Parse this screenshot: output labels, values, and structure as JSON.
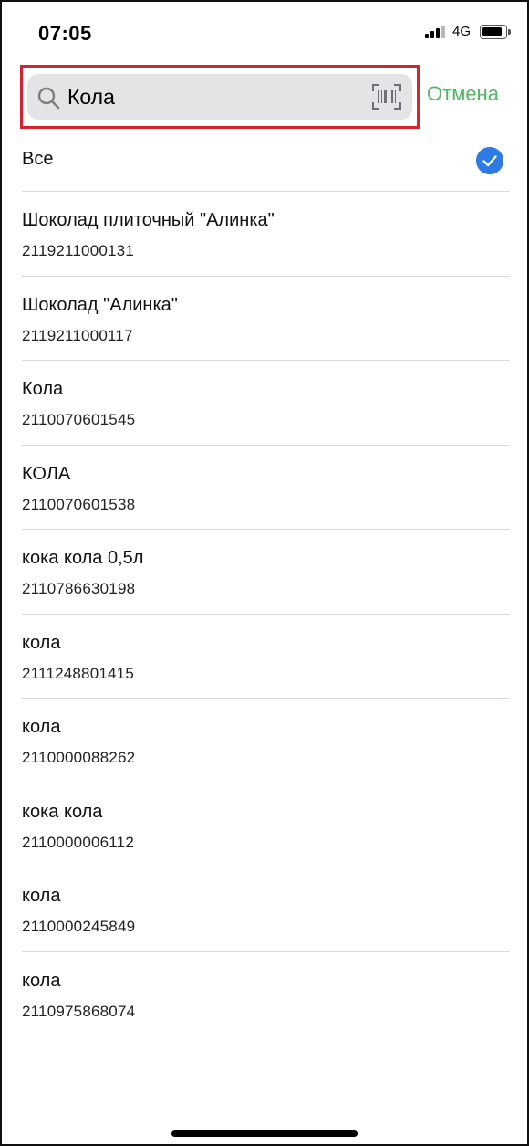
{
  "status_bar": {
    "time": "07:05",
    "network": "4G",
    "signal_icon": "cellular-signal-icon",
    "battery_icon": "battery-icon"
  },
  "search": {
    "value": "Кола",
    "placeholder": "",
    "search_icon": "magnifier-icon",
    "barcode_icon": "barcode-scan-icon",
    "cancel_label": "Отмена",
    "highlight_color": "#d8222f",
    "cancel_color": "#4cbb5f"
  },
  "list": {
    "all_label": "Все",
    "all_selected": true,
    "check_color": "#2f7be6",
    "items": [
      {
        "title": "Шоколад плиточный \"Алинка\"",
        "code": "2119211000131"
      },
      {
        "title": "Шоколад \"Алинка\"",
        "code": "2119211000117"
      },
      {
        "title": "Кола",
        "code": "2110070601545"
      },
      {
        "title": "КОЛА",
        "code": "2110070601538"
      },
      {
        "title": "кока кола 0,5л",
        "code": "2110786630198"
      },
      {
        "title": "кола",
        "code": "2111248801415"
      },
      {
        "title": "кола",
        "code": "2110000088262"
      },
      {
        "title": "кока кола",
        "code": "2110000006112"
      },
      {
        "title": "кола",
        "code": "2110000245849"
      },
      {
        "title": "кола",
        "code": "2110975868074"
      }
    ]
  }
}
